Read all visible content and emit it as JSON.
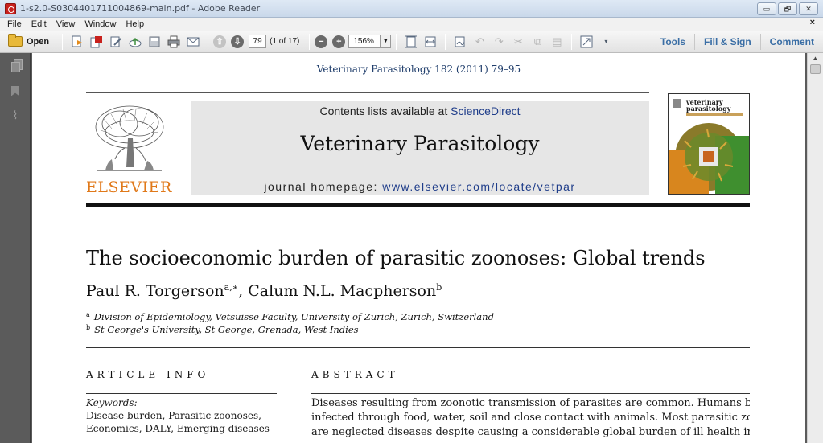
{
  "window": {
    "title": "1-s2.0-S0304401711004869-main.pdf - Adobe Reader",
    "min_label": "▭",
    "max_label": "🗗",
    "close_label": "✕"
  },
  "menu": {
    "items": [
      "File",
      "Edit",
      "View",
      "Window",
      "Help"
    ],
    "close_doc": "×"
  },
  "toolbar": {
    "open_label": "Open",
    "page_number": "79",
    "page_count": "(1 of 17)",
    "zoom": "156%",
    "zoom_drop": "▼",
    "prev_page": "⇧",
    "next_page": "⇩",
    "zoom_out": "−",
    "zoom_in": "+",
    "tabs": [
      "Tools",
      "Fill & Sign",
      "Comment"
    ]
  },
  "document": {
    "journal_ref": "Veterinary Parasitology 182 (2011) 79–95",
    "contents_prefix": "Contents lists available at ",
    "contents_link": "ScienceDirect",
    "journal_title": "Veterinary Parasitology",
    "homepage_prefix": "journal homepage: ",
    "homepage_url": "www.elsevier.com/locate/vetpar",
    "publisher": "ELSEVIER",
    "cover_title": "veterinary parasitology",
    "article_title": "The socioeconomic burden of parasitic zoonoses: Global trends",
    "author1": "Paul R. Torgerson",
    "author1_sup": "a,∗",
    "author_sep": ", ",
    "author2": "Calum N.L. Macpherson",
    "author2_sup": "b",
    "affiliations": [
      {
        "mark": "a",
        "text": "Division of Epidemiology, Vetsuisse Faculty, University of Zurich, Zurich, Switzerland"
      },
      {
        "mark": "b",
        "text": "St George's University, St George, Grenada, West Indies"
      }
    ],
    "article_info_heading": "ARTICLE INFO",
    "abstract_heading": "ABSTRACT",
    "keywords_label": "Keywords:",
    "keyword_lines": [
      "Disease burden, Parasitic zoonoses,",
      "Economics, DALY, Emerging diseases"
    ],
    "abstract_lines": [
      "Diseases resulting from zoonotic transmission of parasites are common. Humans become",
      "infected through food, water, soil and close contact with animals. Most parasitic zoonoses",
      "are neglected diseases despite causing a considerable global burden of ill health in humans"
    ]
  },
  "colors": {
    "link_blue": "#1f3d8a",
    "elsevier_orange": "#e0791a",
    "tab_blue": "#3a6ea5"
  },
  "icons": [
    "pdf-app-icon",
    "folder-icon",
    "create-pdf-icon",
    "export-icon",
    "edit-icon",
    "cloud-icon",
    "save-icon",
    "print-icon",
    "email-icon",
    "prev-page-icon",
    "next-page-icon",
    "zoom-out-icon",
    "zoom-in-icon",
    "fit-page-icon",
    "fit-width-icon",
    "sign-icon",
    "undo-icon",
    "redo-icon",
    "cut-icon",
    "copy-icon",
    "paste-icon",
    "fullscreen-icon",
    "pages-icon",
    "bookmark-icon",
    "attachment-icon"
  ]
}
